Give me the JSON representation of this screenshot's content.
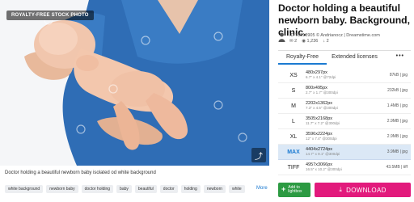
{
  "photo": {
    "badge": "ROYALTY-FREE STOCK PHOTO",
    "caption": "Doctor holding a beautiful newborn baby isolated od white background"
  },
  "tags": [
    "white background",
    "newborn baby",
    "doctor holding",
    "baby",
    "beautiful",
    "doctor",
    "holding",
    "newborn",
    "white"
  ],
  "tags_more": "More",
  "title": "Doctor holding a beautiful newborn baby. Background, clinic.",
  "author": {
    "line": "ID 78818905 © Andrianocz | Dreamstime.com",
    "stats": [
      {
        "icon": "comment-icon",
        "value": "2"
      },
      {
        "icon": "eye-icon",
        "value": "1,236"
      },
      {
        "icon": "download-icon",
        "value": "2"
      }
    ]
  },
  "tabs": {
    "royalty_free": "Royalty-Free",
    "extended": "Extended licenses",
    "menu": "•••"
  },
  "sizes": [
    {
      "code": "XS",
      "px": "480x297px",
      "in": "6.7\" x 4.1\" @72dpi",
      "file": "87kB | jpg",
      "selected": false
    },
    {
      "code": "S",
      "px": "800x495px",
      "in": "2.7\" x 1.7\" @300dpi",
      "file": "232kB | jpg",
      "selected": false
    },
    {
      "code": "M",
      "px": "2202x1362px",
      "in": "7.3\" x 4.5\" @300dpi",
      "file": "1.4MB | jpg",
      "selected": false
    },
    {
      "code": "L",
      "px": "3505x2168px",
      "in": "11.7\" x 7.2\" @300dpi",
      "file": "2.9MB | jpg",
      "selected": false
    },
    {
      "code": "XL",
      "px": "3596x2224px",
      "in": "12\" x 7.4\" @300dpi",
      "file": "2.9MB | jpg",
      "selected": false
    },
    {
      "code": "MAX",
      "px": "4404x2724px",
      "in": "14.7\" x 9.1\" @300dpi",
      "file": "3.9MB | jpg",
      "selected": true
    },
    {
      "code": "TIFF",
      "px": "4957x3066px",
      "in": "16.5\" x 10.2\" @300dpi",
      "file": "43.5MB | tiff",
      "selected": false
    }
  ],
  "actions": {
    "lightbox": "Add to lightbox",
    "download": "DOWNLOAD"
  },
  "colors": {
    "accent": "#1b7ad1",
    "download": "#e21a7c",
    "lightbox": "#2c9a42",
    "scrub": "#2b6cb3"
  }
}
